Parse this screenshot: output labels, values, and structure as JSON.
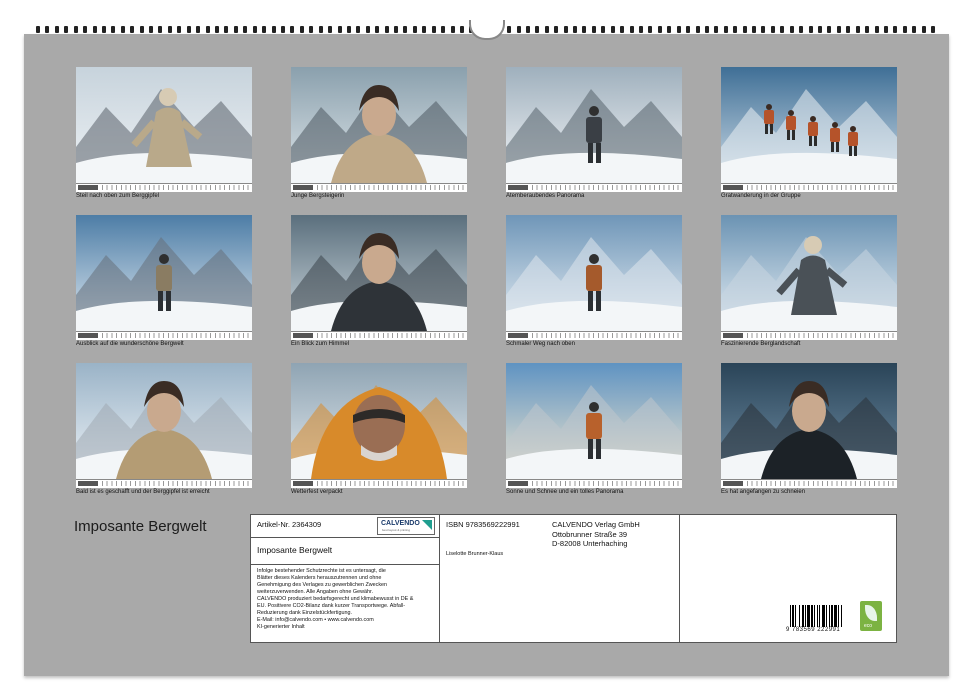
{
  "calendar": {
    "title": "Imposante Bergwelt",
    "photos": [
      {
        "caption": "Steil nach oben zum Berggipfel",
        "scene": "climber-ascent-snow"
      },
      {
        "caption": "Junge Bergsteigerin",
        "scene": "young-woman-climber"
      },
      {
        "caption": "Atemberaubendes Panorama",
        "scene": "climber-back-panorama"
      },
      {
        "caption": "Gratwanderung in der Gruppe",
        "scene": "group-on-ridge"
      },
      {
        "caption": "Ausblick auf die wunderschöne Bergwelt",
        "scene": "hikers-viewpoint"
      },
      {
        "caption": "Ein Blick zum Himmel",
        "scene": "woman-looking-up"
      },
      {
        "caption": "Schmaler Weg nach oben",
        "scene": "narrow-path-climber"
      },
      {
        "caption": "Faszinierende Berglandschaft",
        "scene": "climber-in-ice"
      },
      {
        "caption": "Bald ist es geschafft und der Berggipfel ist erreicht",
        "scene": "climbers-near-summit"
      },
      {
        "caption": "Wetterfest verpackt",
        "scene": "man-orange-parka"
      },
      {
        "caption": "Sonne und Schnee und ein tolles Panorama",
        "scene": "sunny-panorama-climber"
      },
      {
        "caption": "Es hat angefangen zu schneien",
        "scene": "woman-snowfall"
      }
    ]
  },
  "info": {
    "article": "Artikel-Nr. 2364309",
    "brand": "CALVENDO",
    "brand_sub": "best layout & printing",
    "product_title": "Imposante Bergwelt",
    "legal_lines": [
      "Infolge bestehender Schutzrechte ist es untersagt, die",
      "Blätter dieses Kalenders herauszutrennen und ohne",
      "Genehmigung des Verlages zu gewerblichen Zwecken",
      "weiterzuverwenden. Alle Angaben ohne Gewähr.",
      "CALVENDO produziert bedarfsgerecht und klimabewusst in DE &",
      "EU. Positivere CO2-Bilanz dank kurzer Transportwege. Abfall-",
      "Reduzierung dank Einzelstückfertigung.",
      "E-Mail: info@calvendo.com • www.calvendo.com",
      "KI-generierter Inhalt"
    ],
    "isbn": "ISBN 9783569222991",
    "author": "Liselotte Brunner-Klaus",
    "publisher_lines": [
      "CALVENDO Verlag GmbH",
      "Ottobrunner Straße 39",
      "D-82008 Unterhaching"
    ],
    "barcode_number": "9 783569 222991",
    "eco_label": "eco",
    "eco_icon": "leaf-icon"
  }
}
